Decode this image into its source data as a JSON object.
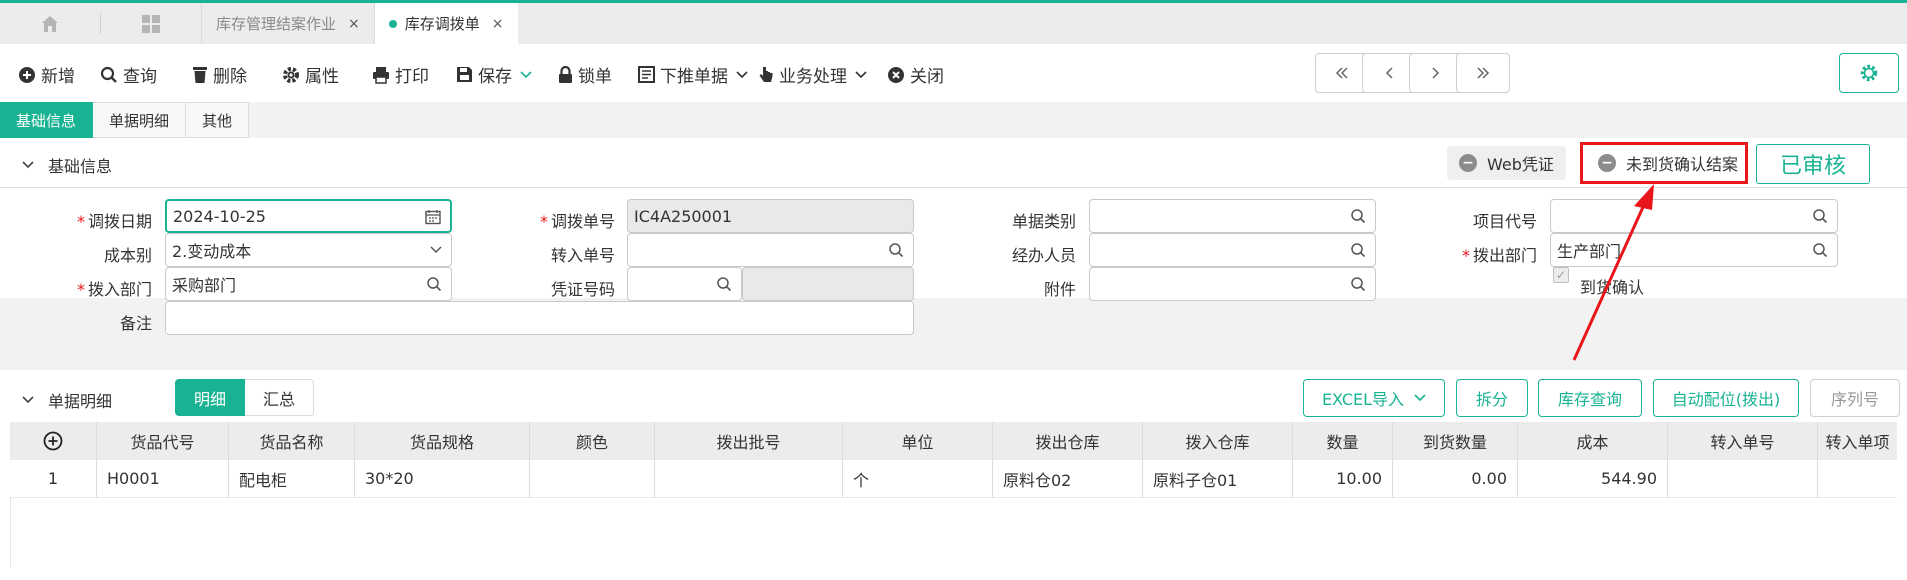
{
  "tabs": {
    "items": [
      {
        "label": "库存管理结案作业",
        "active": false
      },
      {
        "label": "库存调拨单",
        "active": true
      }
    ],
    "close_glyph": "×"
  },
  "toolbar": {
    "add": "新增",
    "query": "查询",
    "delete": "删除",
    "properties": "属性",
    "print": "打印",
    "save": "保存",
    "lock": "锁单",
    "push_down": "下推单据",
    "business": "业务处理",
    "close": "关闭"
  },
  "subtabs": [
    "基础信息",
    "单据明细",
    "其他"
  ],
  "basic_info": {
    "title": "基础信息",
    "web_voucher": "Web凭证",
    "unconfirmed_close": "未到货确认结案",
    "status": "已审核",
    "fields": {
      "transfer_date_label": "调拨日期",
      "transfer_date": "2024-10-25",
      "transfer_no_label": "调拨单号",
      "transfer_no": "IC4A250001",
      "doc_type_label": "单据类别",
      "doc_type": "",
      "project_code_label": "项目代号",
      "project_code": "",
      "cost_type_label": "成本别",
      "cost_type": "2.变动成本",
      "in_no_label": "转入单号",
      "in_no": "",
      "handler_label": "经办人员",
      "handler": "",
      "out_dept_label": "拨出部门",
      "out_dept": "生产部门",
      "in_dept_label": "拨入部门",
      "in_dept": "采购部门",
      "voucher_no_label": "凭证号码",
      "voucher_no": "",
      "attachment_label": "附件",
      "attachment": "",
      "arrival_confirm_label": "到货确认",
      "remark_label": "备注",
      "remark": ""
    }
  },
  "detail": {
    "title": "单据明细",
    "seg_detail": "明细",
    "seg_summary": "汇总",
    "btn_excel": "EXCEL导入",
    "btn_split": "拆分",
    "btn_stock": "库存查询",
    "btn_alloc": "自动配位(拨出)",
    "btn_serial": "序列号",
    "columns": [
      "货品代号",
      "货品名称",
      "货品规格",
      "颜色",
      "拨出批号",
      "单位",
      "拨出仓库",
      "拨入仓库",
      "数量",
      "到货数量",
      "成本",
      "转入单号",
      "转入单项"
    ],
    "rows": [
      {
        "idx": "1",
        "code": "H0001",
        "name": "配电柜",
        "spec": "30*20",
        "color": "",
        "batch": "",
        "unit": "个",
        "out_wh": "原料仓02",
        "in_wh": "原料子仓01",
        "qty": "10.00",
        "arrived": "0.00",
        "cost": "544.90",
        "in_no": "",
        "in_item": ""
      }
    ]
  },
  "colors": {
    "accent": "#19b394",
    "highlight": "#e8161b"
  }
}
